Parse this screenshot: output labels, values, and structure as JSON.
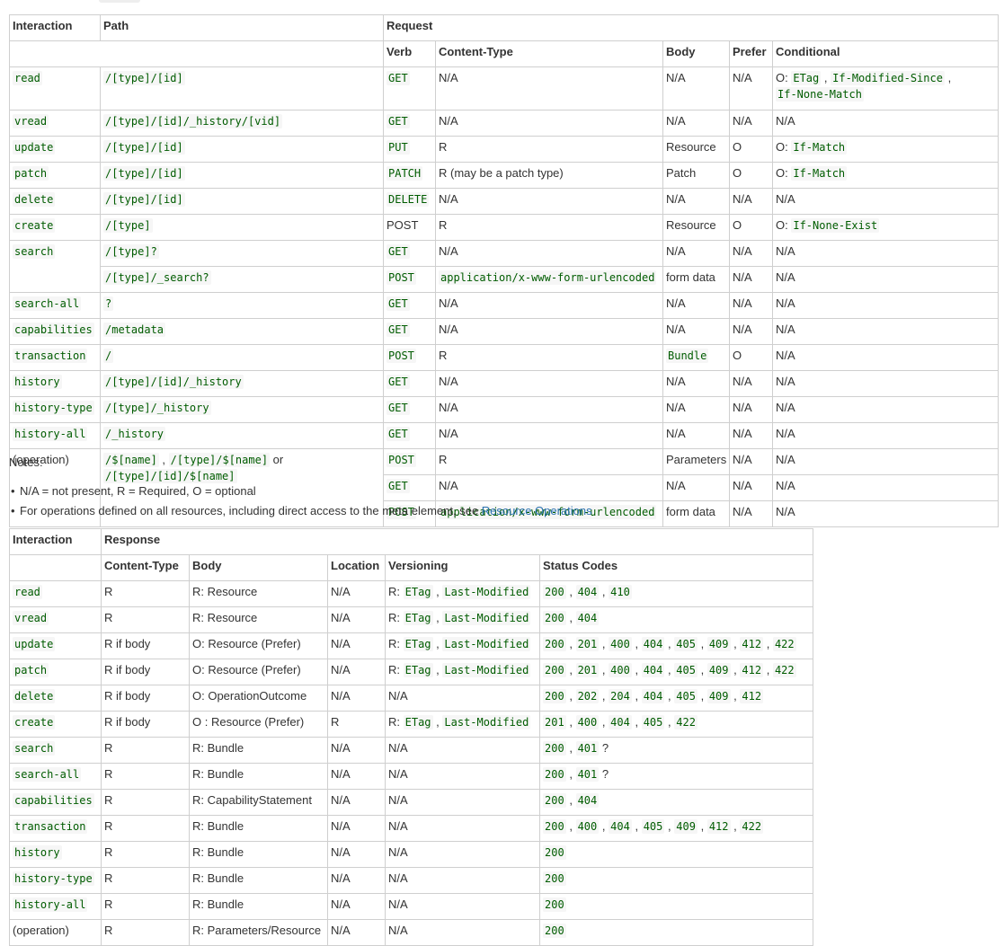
{
  "request_table": {
    "headers": {
      "interaction": "Interaction",
      "path": "Path",
      "request": "Request",
      "verb": "Verb",
      "content_type": "Content-Type",
      "body": "Body",
      "prefer": "Prefer",
      "conditional": "Conditional"
    },
    "cond_prefix": "O:",
    "sep": ",",
    "or": "or",
    "rows": {
      "read": {
        "interaction": "read",
        "path": "/[type]/[id]",
        "verb": "GET",
        "ct": "N/A",
        "body": "N/A",
        "prefer": "N/A",
        "cond": [
          "ETag",
          "If-Modified-Since",
          "If-None-Match"
        ]
      },
      "vread": {
        "interaction": "vread",
        "path": "/[type]/[id]/_history/[vid]",
        "verb": "GET",
        "ct": "N/A",
        "body": "N/A",
        "prefer": "N/A",
        "cond": "N/A"
      },
      "update": {
        "interaction": "update",
        "path": "/[type]/[id]",
        "verb": "PUT",
        "ct": "R",
        "body": "Resource",
        "prefer": "O",
        "cond": "If-Match"
      },
      "patch": {
        "interaction": "patch",
        "path": "/[type]/[id]",
        "verb": "PATCH",
        "ct": "R (may be a patch type)",
        "body": "Patch",
        "prefer": "O",
        "cond": "If-Match"
      },
      "delete": {
        "interaction": "delete",
        "path": "/[type]/[id]",
        "verb": "DELETE",
        "ct": "N/A",
        "body": "N/A",
        "prefer": "N/A",
        "cond": "N/A"
      },
      "create": {
        "interaction": "create",
        "path": "/[type]",
        "verb": "POST",
        "ct": "R",
        "body": "Resource",
        "prefer": "O",
        "cond": "If-None-Exist"
      },
      "search": {
        "interaction": "search",
        "path": "/[type]?",
        "verb": "GET",
        "ct": "N/A",
        "body": "N/A",
        "prefer": "N/A",
        "cond": "N/A"
      },
      "search2": {
        "path": "/[type]/_search?",
        "verb": "POST",
        "ct": "application/x-www-form-urlencoded",
        "body": "form data",
        "prefer": "N/A",
        "cond": "N/A"
      },
      "search_all": {
        "interaction": "search-all",
        "path": "?",
        "verb": "GET",
        "ct": "N/A",
        "body": "N/A",
        "prefer": "N/A",
        "cond": "N/A"
      },
      "capabilities": {
        "interaction": "capabilities",
        "path": "/metadata",
        "verb": "GET",
        "ct": "N/A",
        "body": "N/A",
        "prefer": "N/A",
        "cond": "N/A"
      },
      "transaction": {
        "interaction": "transaction",
        "path": "/",
        "verb": "POST",
        "ct": "R",
        "body": "Bundle",
        "prefer": "O",
        "cond": "N/A"
      },
      "history": {
        "interaction": "history",
        "path": "/[type]/[id]/_history",
        "verb": "GET",
        "ct": "N/A",
        "body": "N/A",
        "prefer": "N/A",
        "cond": "N/A"
      },
      "history_type": {
        "interaction": "history-type",
        "path": "/[type]/_history",
        "verb": "GET",
        "ct": "N/A",
        "body": "N/A",
        "prefer": "N/A",
        "cond": "N/A"
      },
      "history_all": {
        "interaction": "history-all",
        "path": "/_history",
        "verb": "GET",
        "ct": "N/A",
        "body": "N/A",
        "prefer": "N/A",
        "cond": "N/A"
      },
      "operation": {
        "interaction": "(operation)",
        "paths": [
          "/$[name]",
          "/[type]/$[name]",
          "/[type]/[id]/$[name]"
        ],
        "verb": "POST",
        "ct": "R",
        "body": "Parameters",
        "prefer": "N/A",
        "cond": "N/A"
      },
      "operation2": {
        "verb": "GET",
        "ct": "N/A",
        "body": "N/A",
        "prefer": "N/A",
        "cond": "N/A"
      },
      "operation3": {
        "verb": "POST",
        "ct": "application/x-www-form-urlencoded",
        "body": "form data",
        "prefer": "N/A",
        "cond": "N/A"
      }
    }
  },
  "notes": {
    "title": "Notes:",
    "item1": "N/A = not present, R = Required, O = optional",
    "item2_text": "For operations defined on all resources, including direct access to the meta element, see",
    "item2_link": "Resource Operations"
  },
  "response_table": {
    "headers": {
      "interaction": "Interaction",
      "response": "Response",
      "content_type": "Content-Type",
      "body": "Body",
      "location": "Location",
      "versioning": "Versioning",
      "status_codes": "Status Codes"
    },
    "ver_prefix": "R:",
    "question": "?",
    "rows": {
      "read": {
        "interaction": "read",
        "ct": "R",
        "body": "R: Resource",
        "loc": "N/A",
        "ver": [
          "ETag",
          "Last-Modified"
        ],
        "codes": [
          "200",
          "404",
          "410"
        ]
      },
      "vread": {
        "interaction": "vread",
        "ct": "R",
        "body": "R: Resource",
        "loc": "N/A",
        "ver": [
          "ETag",
          "Last-Modified"
        ],
        "codes": [
          "200",
          "404"
        ]
      },
      "update": {
        "interaction": "update",
        "ct": "R if body",
        "body": "O: Resource (Prefer)",
        "loc": "N/A",
        "ver": [
          "ETag",
          "Last-Modified"
        ],
        "codes": [
          "200",
          "201",
          "400",
          "404",
          "405",
          "409",
          "412",
          "422"
        ]
      },
      "patch": {
        "interaction": "patch",
        "ct": "R if body",
        "body": "O: Resource (Prefer)",
        "loc": "N/A",
        "ver": [
          "ETag",
          "Last-Modified"
        ],
        "codes": [
          "200",
          "201",
          "400",
          "404",
          "405",
          "409",
          "412",
          "422"
        ]
      },
      "delete": {
        "interaction": "delete",
        "ct": "R if body",
        "body": "O: OperationOutcome",
        "loc": "N/A",
        "ver": "N/A",
        "codes": [
          "200",
          "202",
          "204",
          "404",
          "405",
          "409",
          "412"
        ]
      },
      "create": {
        "interaction": "create",
        "ct": "R if body",
        "body": "O : Resource (Prefer)",
        "loc": "R",
        "ver": [
          "ETag",
          "Last-Modified"
        ],
        "codes": [
          "201",
          "400",
          "404",
          "405",
          "422"
        ]
      },
      "search": {
        "interaction": "search",
        "ct": "R",
        "body": "R: Bundle",
        "loc": "N/A",
        "ver": "N/A",
        "codes": [
          "200",
          "401"
        ]
      },
      "search_all": {
        "interaction": "search-all",
        "ct": "R",
        "body": "R: Bundle",
        "loc": "N/A",
        "ver": "N/A",
        "codes": [
          "200",
          "401"
        ]
      },
      "capabilities": {
        "interaction": "capabilities",
        "ct": "R",
        "body": "R: CapabilityStatement",
        "loc": "N/A",
        "ver": "N/A",
        "codes": [
          "200",
          "404"
        ]
      },
      "transaction": {
        "interaction": "transaction",
        "ct": "R",
        "body": "R: Bundle",
        "loc": "N/A",
        "ver": "N/A",
        "codes": [
          "200",
          "400",
          "404",
          "405",
          "409",
          "412",
          "422"
        ]
      },
      "history": {
        "interaction": "history",
        "ct": "R",
        "body": "R: Bundle",
        "loc": "N/A",
        "ver": "N/A",
        "codes": [
          "200"
        ]
      },
      "history_type": {
        "interaction": "history-type",
        "ct": "R",
        "body": "R: Bundle",
        "loc": "N/A",
        "ver": "N/A",
        "codes": [
          "200"
        ]
      },
      "history_all": {
        "interaction": "history-all",
        "ct": "R",
        "body": "R: Bundle",
        "loc": "N/A",
        "ver": "N/A",
        "codes": [
          "200"
        ]
      },
      "operation": {
        "interaction": "(operation)",
        "ct": "R",
        "body": "R: Parameters/Resource",
        "loc": "N/A",
        "ver": "N/A",
        "codes": [
          "200"
        ]
      }
    }
  }
}
